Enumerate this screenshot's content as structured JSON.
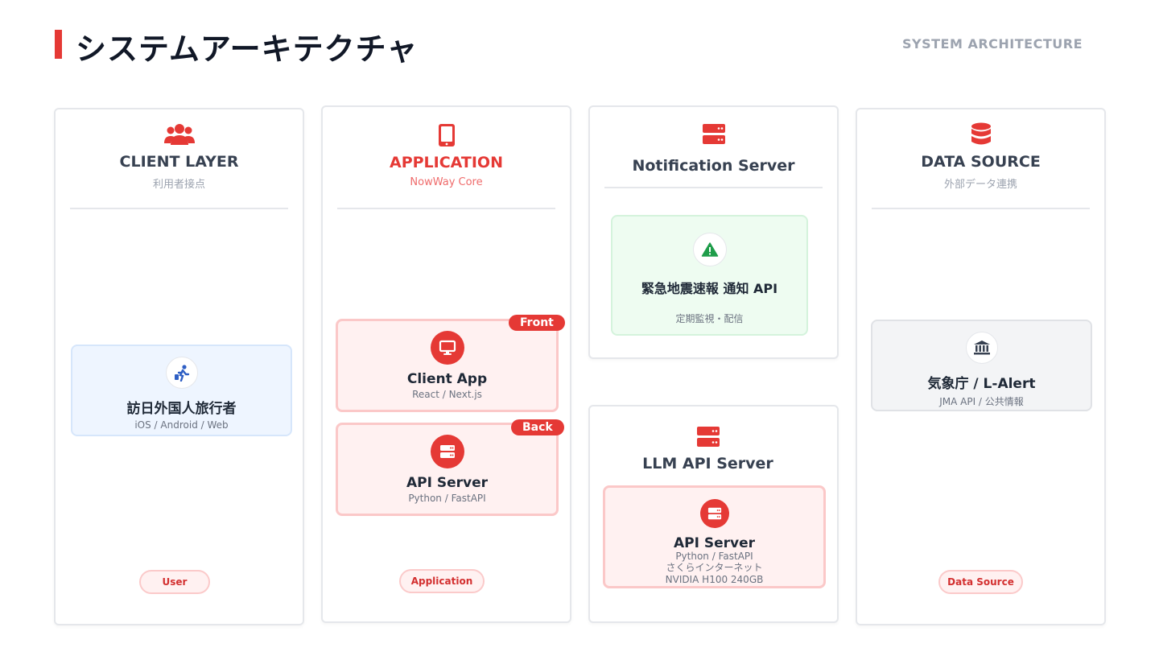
{
  "header": {
    "title": "システムアーキテクチャ",
    "subtitle": "SYSTEM ARCHITECTURE"
  },
  "colors": {
    "accent": "#e53935",
    "blue_card": "#eef5ff",
    "red_card": "#fff1f1",
    "green_card": "#eefcf1",
    "gray_card": "#f3f4f6"
  },
  "client": {
    "icon": "users-icon",
    "title": "CLIENT LAYER",
    "subtitle": "利用者接点",
    "card": {
      "icon": "traveler-icon",
      "title": "訪日外国人旅行者",
      "sub": "iOS / Android / Web"
    },
    "pill": "User"
  },
  "application": {
    "icon": "mobile-icon",
    "title": "APPLICATION",
    "subtitle": "NowWay Core",
    "front": {
      "tag": "Front",
      "icon": "monitor-icon",
      "title": "Client App",
      "sub": "React / Next.js"
    },
    "back": {
      "tag": "Back",
      "icon": "server-icon",
      "title": "API Server",
      "sub": "Python / FastAPI"
    },
    "pill": "Application"
  },
  "notification": {
    "icon": "server-icon",
    "title": "Notification Server",
    "card": {
      "icon": "warning-icon",
      "title": "緊急地震速報 通知 API",
      "sub": "定期監視・配信"
    }
  },
  "llm": {
    "icon": "server-icon",
    "title": "LLM API Server",
    "card": {
      "icon": "server-icon",
      "title": "API Server",
      "line1": "Python / FastAPI",
      "line2": "さくらインターネット",
      "line3": "NVIDIA H100 240GB"
    }
  },
  "datasource": {
    "icon": "database-icon",
    "title": "DATA SOURCE",
    "subtitle": "外部データ連携",
    "card": {
      "icon": "landmark-icon",
      "title": "気象庁 / L-Alert",
      "sub": "JMA API / 公共情報"
    },
    "pill": "Data Source"
  }
}
